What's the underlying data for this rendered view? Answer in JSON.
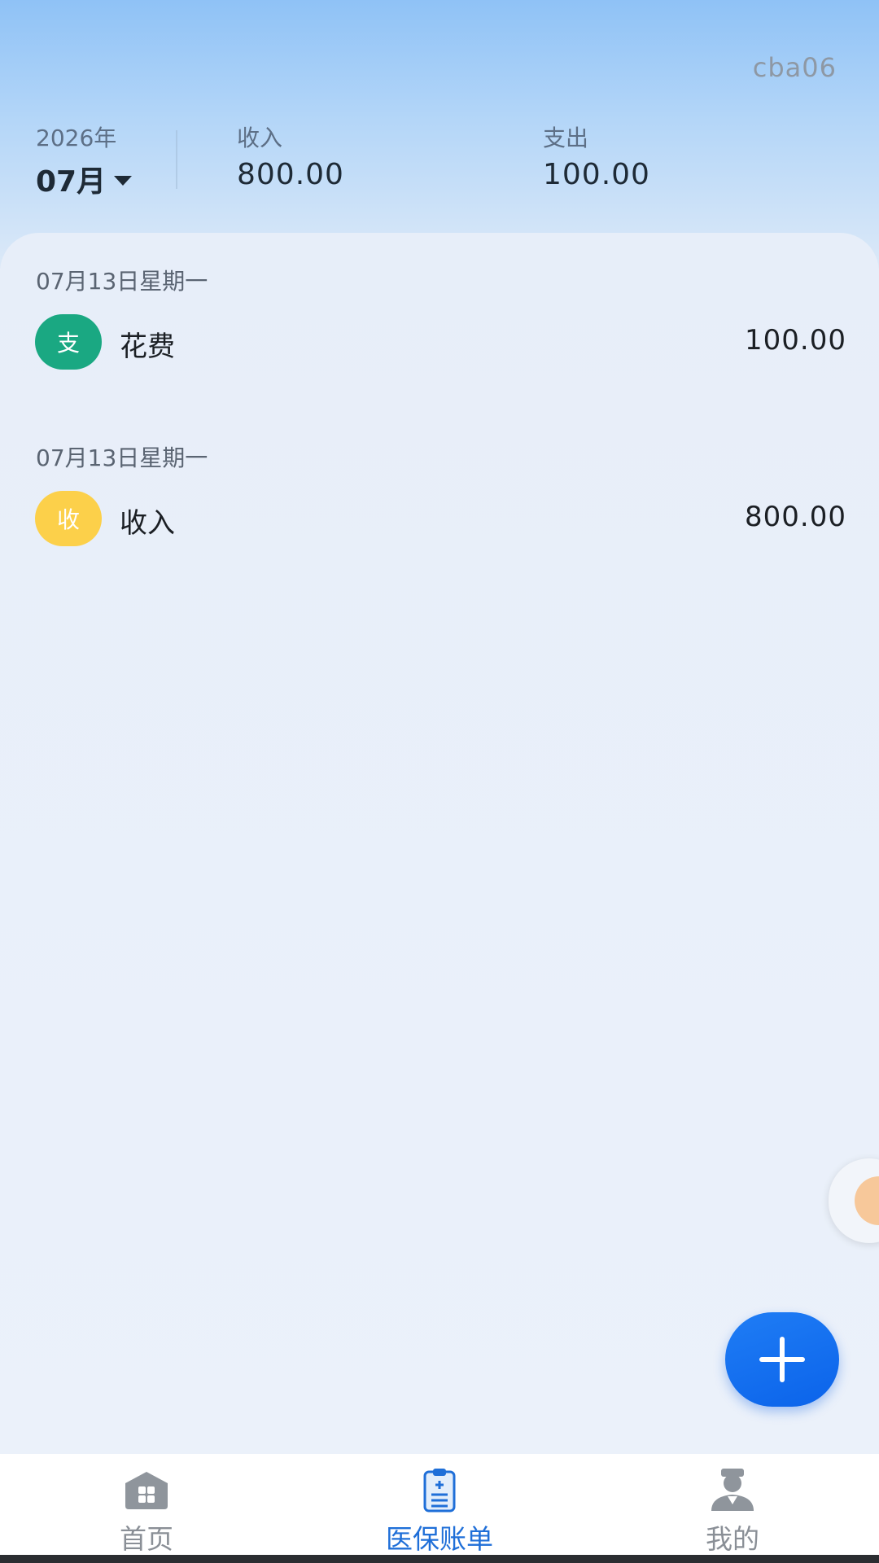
{
  "header": {
    "username": "cba06",
    "year": "2026年",
    "month": "07月",
    "income_label": "收入",
    "income_value": "800.00",
    "expense_label": "支出",
    "expense_value": "100.00"
  },
  "records": [
    {
      "date": "07月13日星期一",
      "badge": "支",
      "badge_color": "#1aa882",
      "name": "花费",
      "amount": "100.00"
    },
    {
      "date": "07月13日星期一",
      "badge": "收",
      "badge_color": "#fcd04a",
      "name": "收入",
      "amount": "800.00"
    }
  ],
  "tabbar": {
    "tabs": [
      {
        "label": "首页",
        "icon": "home-icon",
        "active": false
      },
      {
        "label": "医保账单",
        "icon": "clipboard-icon",
        "active": true
      },
      {
        "label": "我的",
        "icon": "user-icon",
        "active": false
      }
    ]
  },
  "colors": {
    "accent": "#1f6fd8",
    "fab": "#1a78f2",
    "expense_badge": "#1aa882",
    "income_badge": "#fcd04a"
  },
  "fab": {
    "icon": "plus-icon"
  }
}
